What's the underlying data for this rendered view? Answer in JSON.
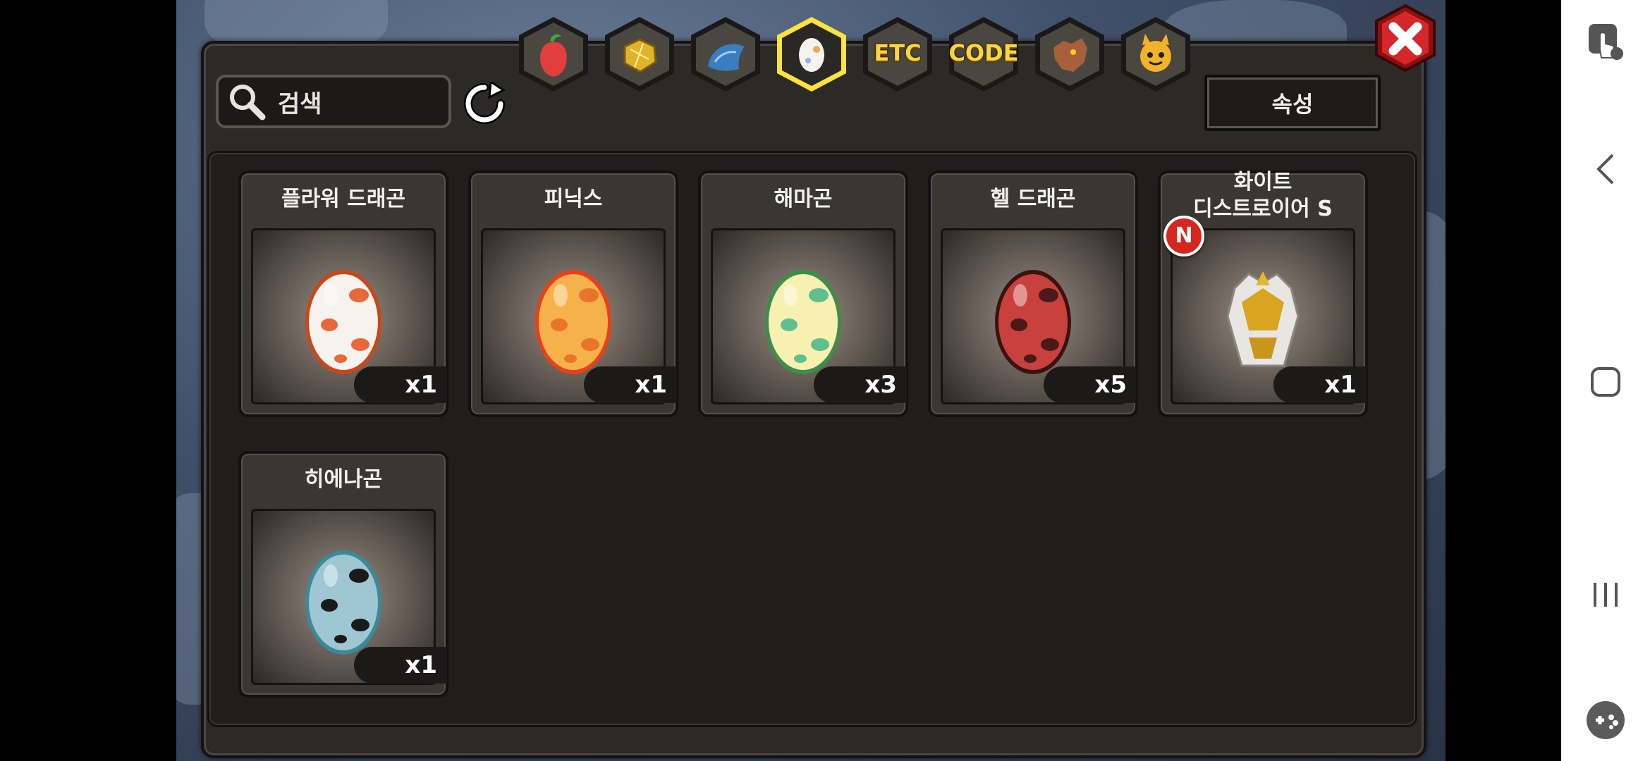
{
  "search": {
    "placeholder": "검색"
  },
  "attribute_button": {
    "label": "속성"
  },
  "tabs": [
    {
      "id": "fruit",
      "icon": "fruit-icon",
      "label": ""
    },
    {
      "id": "ore",
      "icon": "ore-icon",
      "label": ""
    },
    {
      "id": "scale",
      "icon": "scale-icon",
      "label": ""
    },
    {
      "id": "egg",
      "icon": "egg-icon",
      "label": "",
      "selected": true
    },
    {
      "id": "etc",
      "icon": "etc-icon",
      "label": "ETC"
    },
    {
      "id": "code",
      "icon": "code-icon",
      "label": "CODE"
    },
    {
      "id": "dragon",
      "icon": "dragon-head-icon",
      "label": ""
    },
    {
      "id": "pet",
      "icon": "pet-face-icon",
      "label": ""
    }
  ],
  "items": [
    {
      "name": "플라워 드래곤",
      "count": "x1",
      "icon": "flower-dragon-egg-icon",
      "colors": {
        "shell": "#f6f2ee",
        "spots": "#e8683a",
        "rim": "#c8481a"
      }
    },
    {
      "name": "피닉스",
      "count": "x1",
      "icon": "phoenix-egg-icon",
      "colors": {
        "shell": "#f6b24a",
        "spots": "#e8752a",
        "rim": "#e8401a"
      }
    },
    {
      "name": "해마곤",
      "count": "x3",
      "icon": "seahorse-egg-icon",
      "colors": {
        "shell": "#f7f0b0",
        "spots": "#5fbf8f",
        "rim": "#3a8f4a"
      }
    },
    {
      "name": "헬 드래곤",
      "count": "x5",
      "icon": "hell-dragon-egg-icon",
      "colors": {
        "shell": "#c9413c",
        "spots": "#4a1a1a",
        "rim": "#3a1210"
      }
    },
    {
      "name_line1": "화이트",
      "name_line2": "디스트로이어 S",
      "count": "x1",
      "icon": "white-destroyer-armor-icon",
      "badge": "N"
    },
    {
      "name": "히에나곤",
      "count": "x1",
      "icon": "hyenagon-egg-icon",
      "colors": {
        "shell": "#9ec6d3",
        "spots": "#1a1a1a",
        "rim": "#3a8a9a"
      }
    }
  ],
  "accent": {
    "selected_tab": "#ffe23a",
    "close": "#d6262a"
  }
}
